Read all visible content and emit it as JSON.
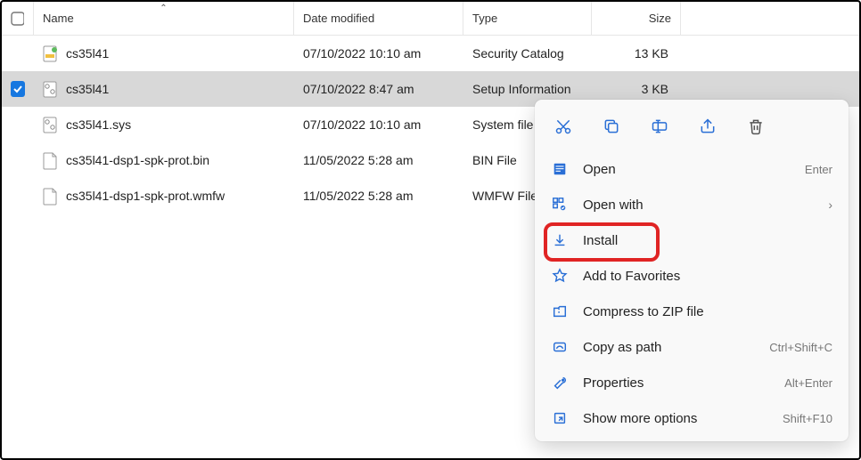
{
  "columns": {
    "name": "Name",
    "date": "Date modified",
    "type": "Type",
    "size": "Size"
  },
  "files": [
    {
      "name": "cs35l41",
      "date": "07/10/2022 10:10 am",
      "type": "Security Catalog",
      "size": "13 KB",
      "icon": "cat"
    },
    {
      "name": "cs35l41",
      "date": "07/10/2022 8:47 am",
      "type": "Setup Information",
      "size": "3 KB",
      "icon": "inf",
      "selected": true
    },
    {
      "name": "cs35l41.sys",
      "date": "07/10/2022 10:10 am",
      "type": "System file",
      "size": "",
      "icon": "sys"
    },
    {
      "name": "cs35l41-dsp1-spk-prot.bin",
      "date": "11/05/2022 5:28 am",
      "type": "BIN File",
      "size": "",
      "icon": "blank"
    },
    {
      "name": "cs35l41-dsp1-spk-prot.wmfw",
      "date": "11/05/2022 5:28 am",
      "type": "WMFW File",
      "size": "",
      "icon": "blank"
    }
  ],
  "context_menu": {
    "top_actions": [
      "cut",
      "copy",
      "rename",
      "share",
      "delete"
    ],
    "items": [
      {
        "label": "Open",
        "shortcut": "Enter",
        "icon": "open"
      },
      {
        "label": "Open with",
        "shortcut": "",
        "icon": "openwith",
        "submenu": true
      },
      {
        "label": "Install",
        "shortcut": "",
        "icon": "install",
        "highlighted": true
      },
      {
        "label": "Add to Favorites",
        "shortcut": "",
        "icon": "star"
      },
      {
        "label": "Compress to ZIP file",
        "shortcut": "",
        "icon": "zip"
      },
      {
        "label": "Copy as path",
        "shortcut": "Ctrl+Shift+C",
        "icon": "path"
      },
      {
        "label": "Properties",
        "shortcut": "Alt+Enter",
        "icon": "props"
      },
      {
        "label": "Show more options",
        "shortcut": "Shift+F10",
        "icon": "more"
      }
    ]
  }
}
